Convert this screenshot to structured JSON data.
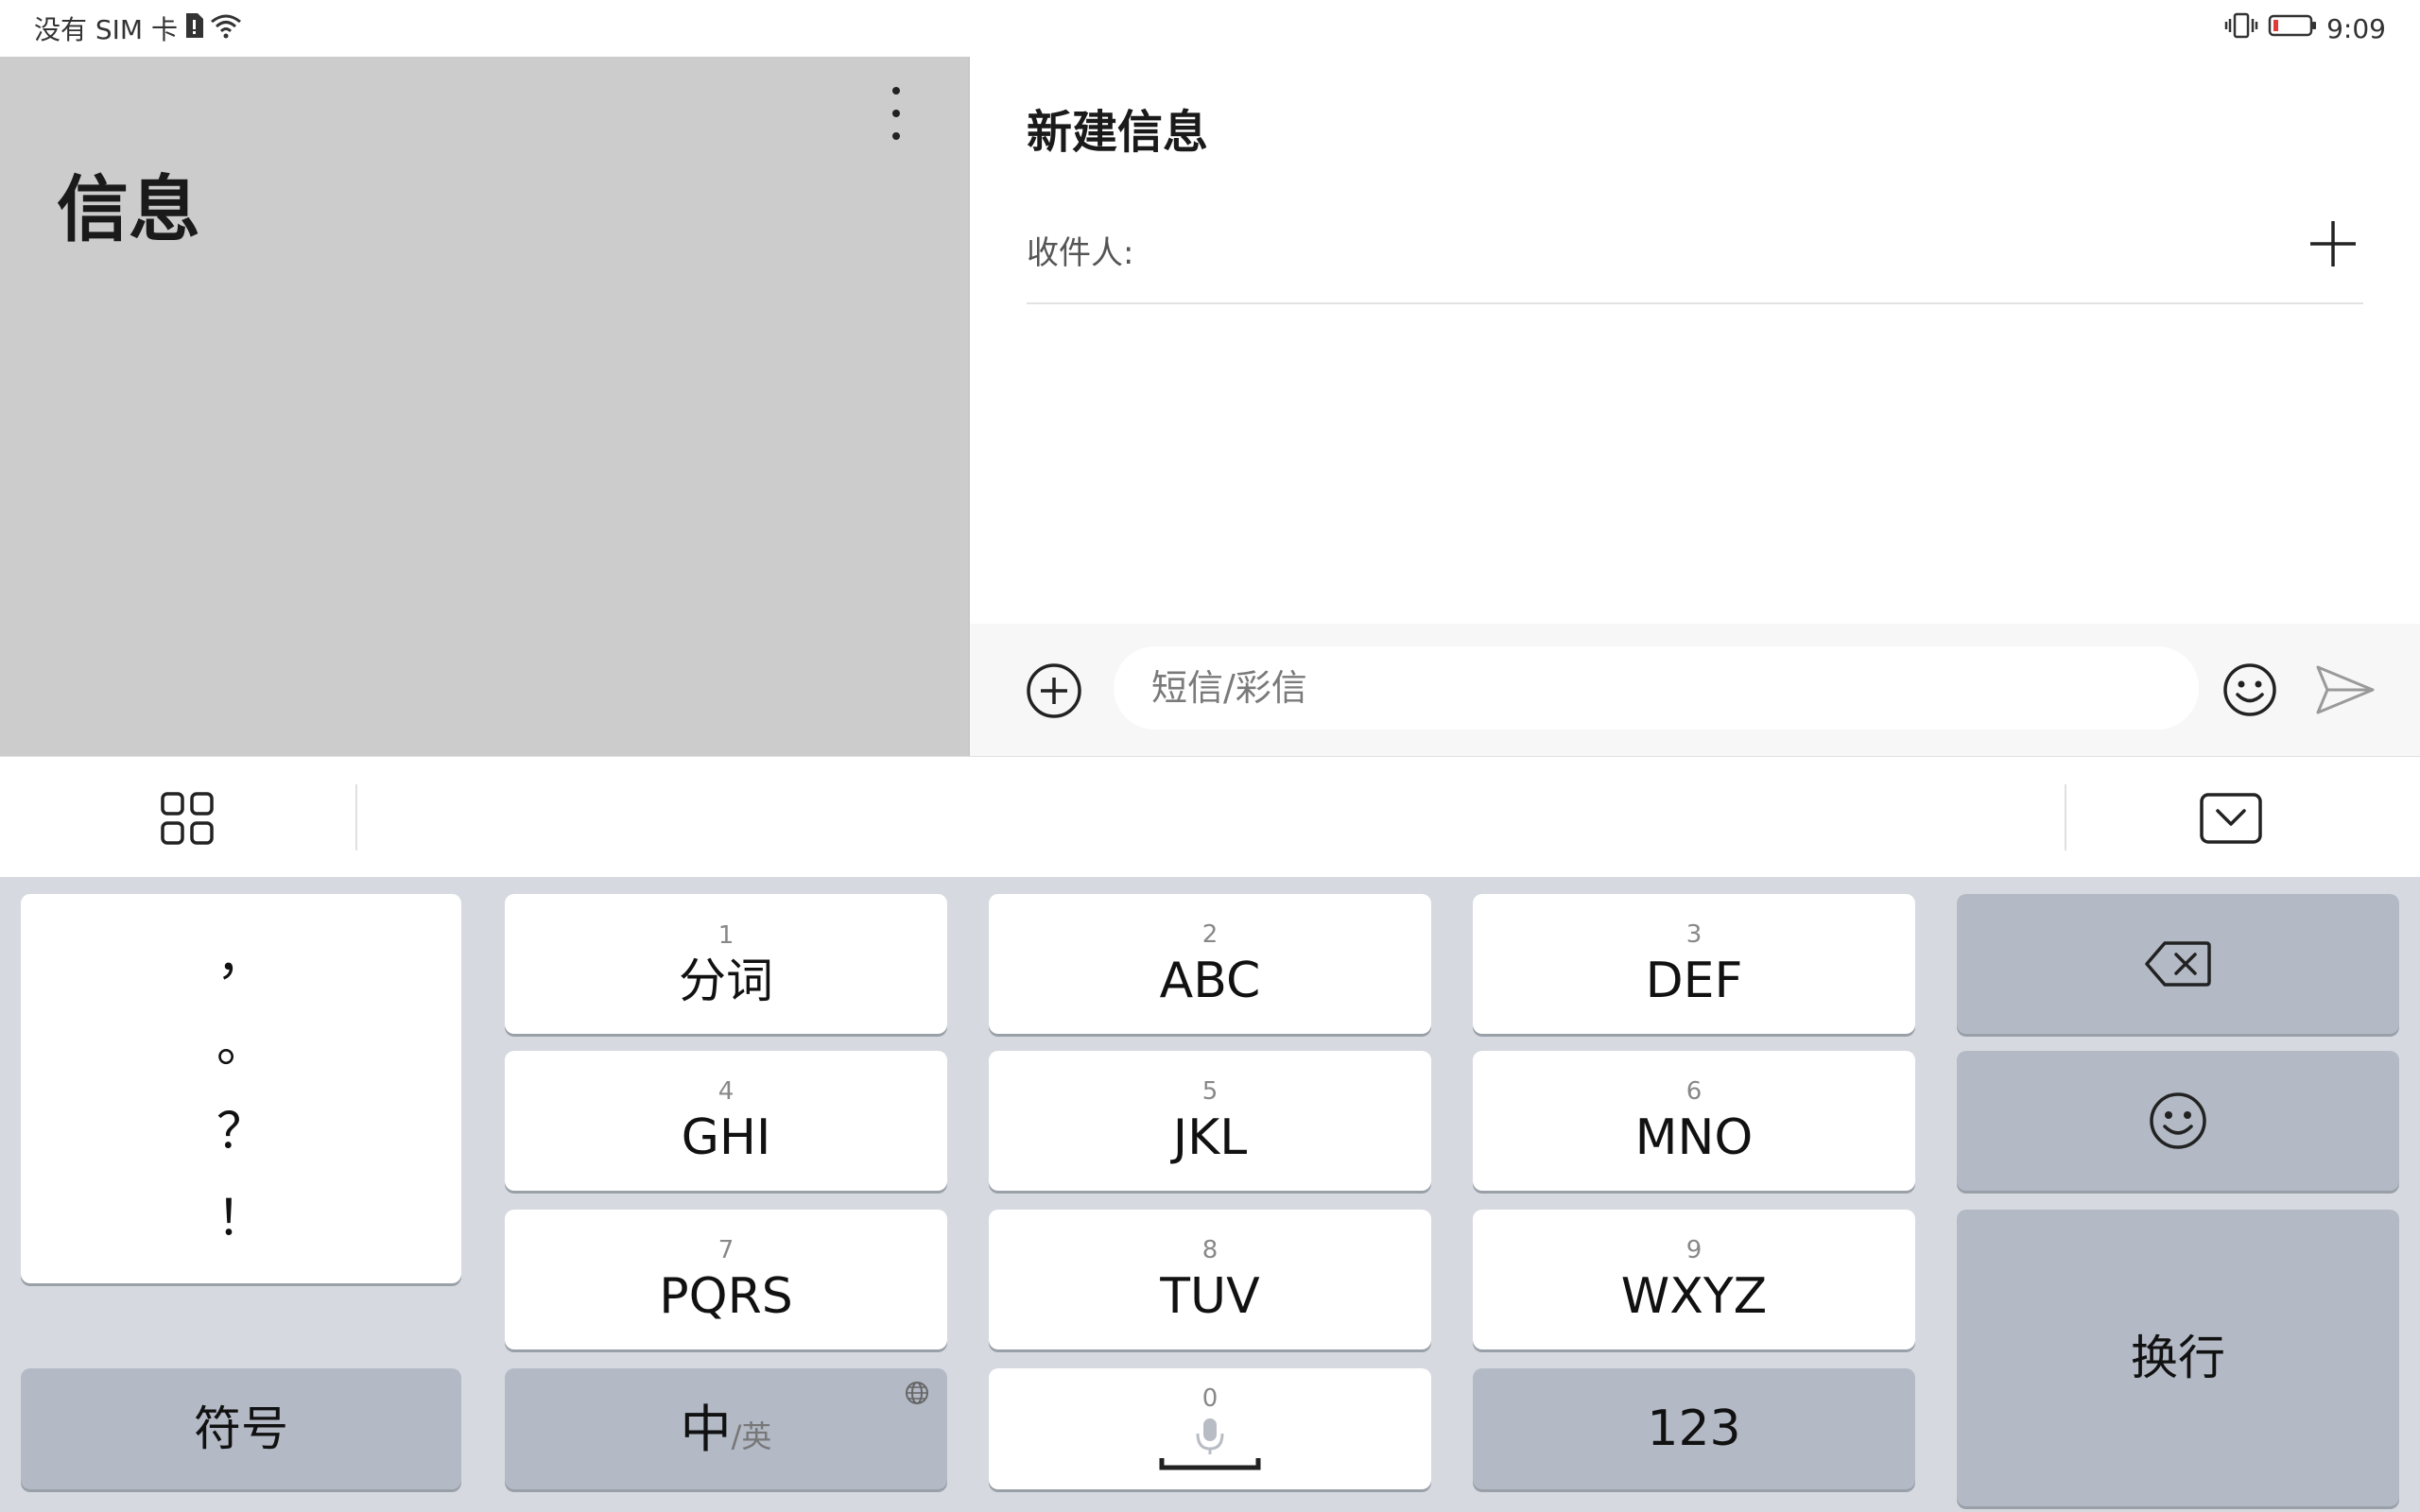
{
  "status_bar": {
    "carrier": "没有 SIM 卡",
    "time": "9:09",
    "icons": [
      "sim-alert-icon",
      "wifi-icon",
      "vibrate-icon",
      "battery-low-icon"
    ]
  },
  "left_pane": {
    "title": "信息",
    "menu_icon": "more-vertical-icon"
  },
  "compose": {
    "title": "新建信息",
    "recipient_label": "收件人:",
    "recipient_add_icon": "plus-icon",
    "message_placeholder": "短信/彩信",
    "message_value": "",
    "attach_icon": "add-circle-icon",
    "emoji_icon": "emoji-icon",
    "send_icon": "send-icon"
  },
  "keyboard_toolbar": {
    "left_icon": "grid-icon",
    "right_icon": "keyboard-hide-icon"
  },
  "keyboard": {
    "punctuation": [
      "，",
      "。",
      "？",
      "！"
    ],
    "rows": [
      [
        {
          "num": "1",
          "label": "分词"
        },
        {
          "num": "2",
          "label": "ABC"
        },
        {
          "num": "3",
          "label": "DEF"
        }
      ],
      [
        {
          "num": "4",
          "label": "GHI"
        },
        {
          "num": "5",
          "label": "JKL"
        },
        {
          "num": "6",
          "label": "MNO"
        }
      ],
      [
        {
          "num": "7",
          "label": "PQRS"
        },
        {
          "num": "8",
          "label": "TUV"
        },
        {
          "num": "9",
          "label": "WXYZ"
        }
      ]
    ],
    "symbol_key": "符号",
    "lang_key_zh": "中",
    "lang_key_en": "/英",
    "space_num": "0",
    "numbers_key": "123",
    "enter_key": "换行",
    "backspace_icon": "backspace-icon",
    "emoji_key_icon": "emoji-icon",
    "globe_icon": "globe-icon",
    "mic_icon": "microphone-icon"
  },
  "colors": {
    "left_pane_bg": "#cccccc",
    "keyboard_bg": "#d6dae0",
    "function_key_bg": "#b3b9c5",
    "battery_low": "#e53935"
  }
}
